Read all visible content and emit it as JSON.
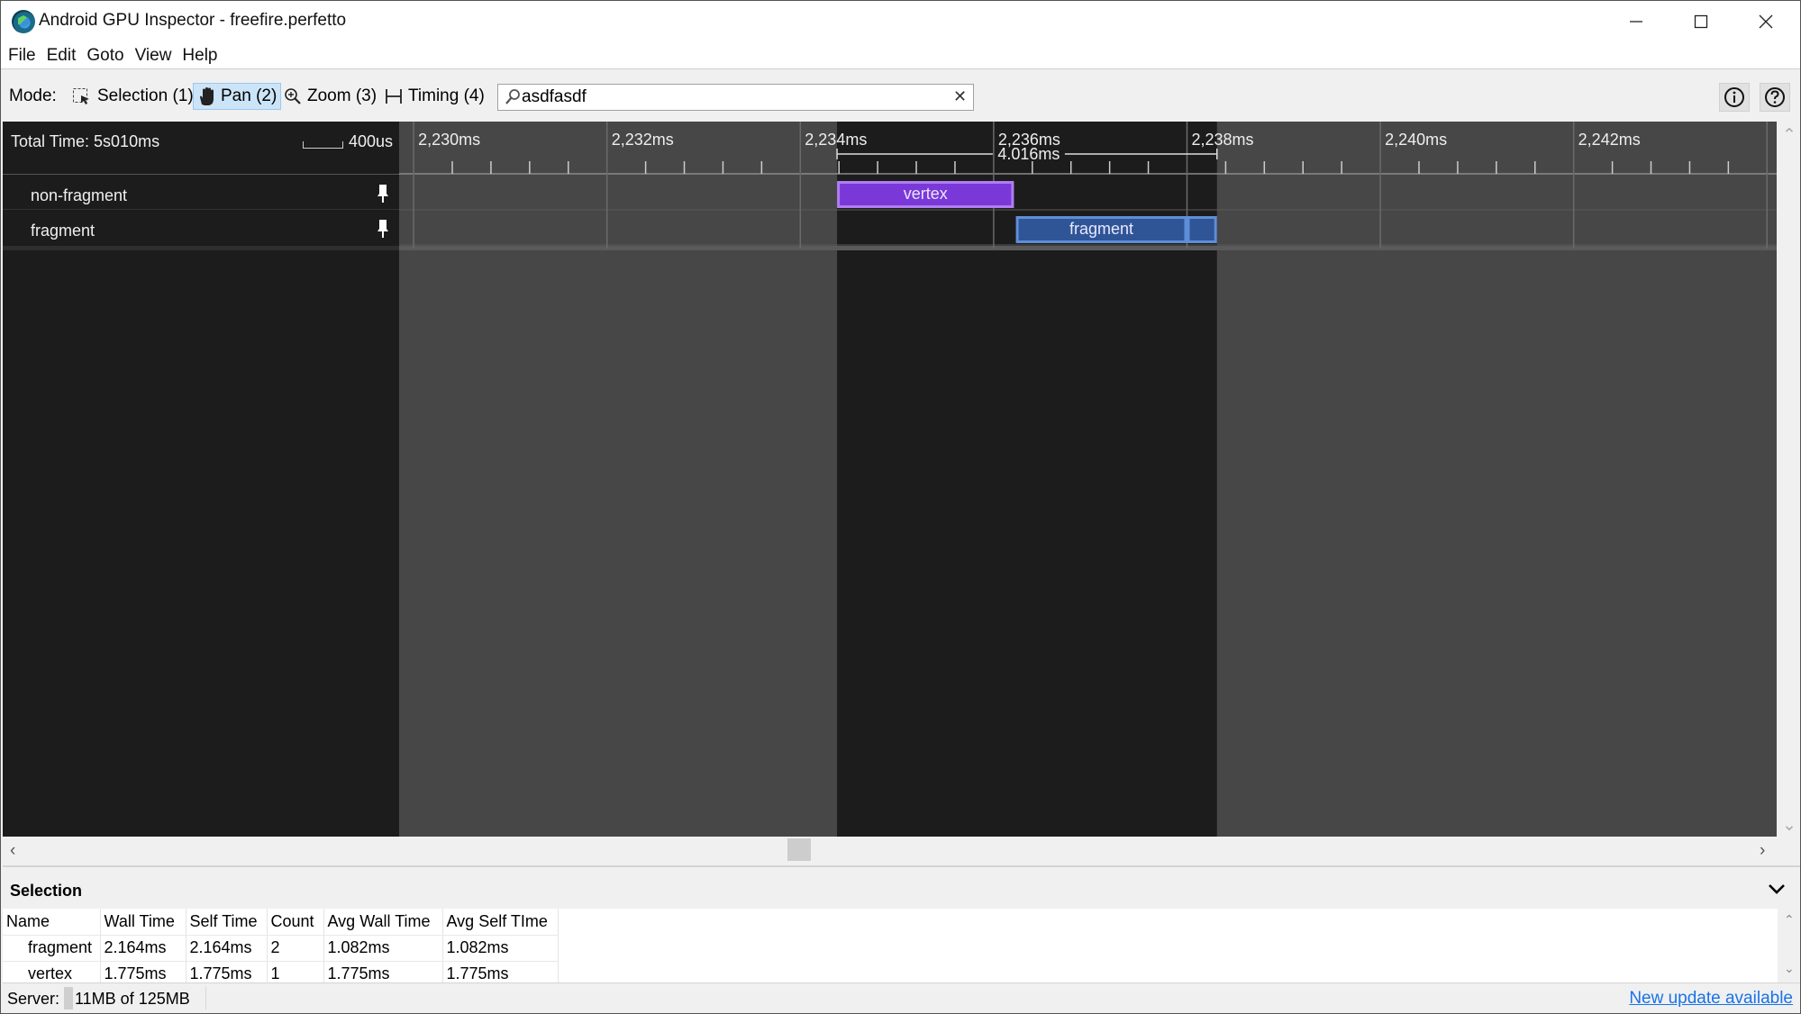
{
  "window": {
    "title": "Android GPU Inspector - freefire.perfetto",
    "controls": {
      "minimize": "—",
      "maximize": "☐",
      "close": "✕"
    }
  },
  "menu": [
    "File",
    "Edit",
    "Goto",
    "View",
    "Help"
  ],
  "toolbar": {
    "mode_label": "Mode:",
    "modes": [
      {
        "label": "Selection (1)",
        "icon": "selection-icon",
        "active": false
      },
      {
        "label": "Pan (2)",
        "icon": "hand-icon",
        "active": true
      },
      {
        "label": "Zoom (3)",
        "icon": "zoom-icon",
        "active": false
      },
      {
        "label": "Timing (4)",
        "icon": "timing-icon",
        "active": false
      }
    ],
    "search": {
      "value": "asdfasdf",
      "placeholder": ""
    },
    "info_icon": "info-icon",
    "help_icon": "help-icon"
  },
  "timeline": {
    "total_time": "Total Time: 5s010ms",
    "scale_label": "400us",
    "ticks": [
      {
        "value": 2230,
        "label": "2,230ms"
      },
      {
        "value": 2232,
        "label": "2,232ms"
      },
      {
        "value": 2234,
        "label": "2,234ms"
      },
      {
        "value": 2236,
        "label": "2,236ms"
      },
      {
        "value": 2238,
        "label": "2,238ms"
      },
      {
        "value": 2240,
        "label": "2,240ms"
      },
      {
        "value": 2242,
        "label": "2,242ms"
      },
      {
        "value": 2244,
        "label": ""
      }
    ],
    "view_range_ms": [
      2229.85,
      2244.1
    ],
    "selection": {
      "start_ms": 2234.38,
      "end_ms": 2238.31,
      "label": "4.016ms"
    },
    "tracks": [
      {
        "name": "non-fragment",
        "slices": [
          {
            "label": "vertex",
            "start_ms": 2234.38,
            "end_ms": 2236.21,
            "color": "#7b38d8",
            "border": "#b07ef0"
          }
        ]
      },
      {
        "name": "fragment",
        "slices": [
          {
            "label": "fragment",
            "start_ms": 2236.23,
            "end_ms": 2238.0,
            "color": "#2f5597",
            "border": "#5f8ed8"
          },
          {
            "label": "",
            "start_ms": 2238.0,
            "end_ms": 2238.31,
            "color": "#2f5597",
            "border": "#5f8ed8"
          }
        ]
      }
    ],
    "colors": {
      "background": "#474747",
      "selection_bg": "#1c1c1c",
      "grid": "#6a6a6a"
    }
  },
  "selection_panel": {
    "title": "Selection",
    "columns": [
      "Name",
      "Wall Time",
      "Self Time",
      "Count",
      "Avg Wall Time",
      "Avg Self TIme"
    ],
    "rows": [
      [
        "fragment",
        "2.164ms",
        "2.164ms",
        "2",
        "1.082ms",
        "1.082ms"
      ],
      [
        "vertex",
        "1.775ms",
        "1.775ms",
        "1",
        "1.775ms",
        "1.775ms"
      ]
    ]
  },
  "status": {
    "server_label": "Server:",
    "memory": "11MB of 125MB",
    "memory_used_fraction": 0.088,
    "update_link": "New update available"
  }
}
